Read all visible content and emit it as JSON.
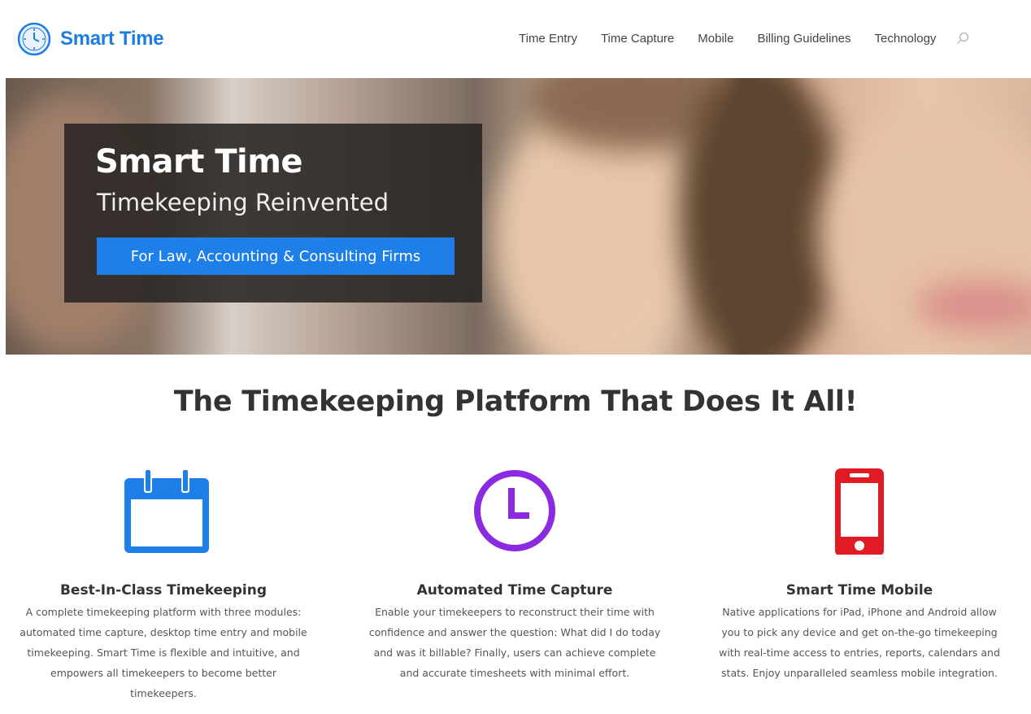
{
  "brand": {
    "name": "Smart Time",
    "accent": "#1d7de0"
  },
  "nav": {
    "items": [
      "Time Entry",
      "Time Capture",
      "Mobile",
      "Billing Guidelines",
      "Technology"
    ],
    "search_icon": "search-icon"
  },
  "hero": {
    "title": "Smart Time",
    "subtitle": "Timekeeping Reinvented",
    "cta": "For Law, Accounting & Consulting Firms",
    "cta_color": "#1f7fe8"
  },
  "headline": "The Timekeeping Platform That Does It All!",
  "features": [
    {
      "icon": "calendar-icon",
      "color": "#1f7fe8",
      "title": "Best-In-Class Timekeeping",
      "text": "A complete timekeeping platform with three modules: automated time capture, desktop time entry and mobile timekeeping. Smart Time is flexible and intuitive, and empowers all timekeepers to become better timekeepers."
    },
    {
      "icon": "clock-icon",
      "color": "#8a2be2",
      "title": "Automated Time Capture",
      "text": "Enable your timekeepers to reconstruct their time with confidence and answer the question: What did I do today and was it billable? Finally, users can achieve complete and accurate timesheets with minimal effort."
    },
    {
      "icon": "smartphone-icon",
      "color": "#e01b24",
      "title": "Smart Time Mobile",
      "text": "Native applications for iPad, iPhone and Android allow you to pick any device and get on-the-go timekeeping with real-time access to entries, reports, calendars and stats. Enjoy unparalleled seamless mobile integration."
    }
  ]
}
